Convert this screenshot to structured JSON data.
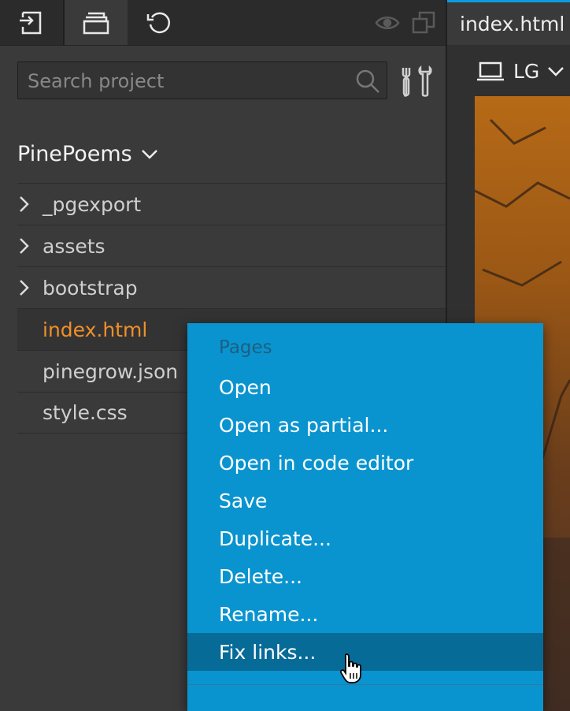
{
  "toolbar": {
    "buttons": [
      {
        "icon": "import-icon"
      },
      {
        "icon": "archive-icon"
      },
      {
        "icon": "refresh-icon"
      },
      {
        "icon": "eye-icon"
      },
      {
        "icon": "copy-icon"
      }
    ]
  },
  "search": {
    "placeholder": "Search project",
    "value": ""
  },
  "project": {
    "name": "PinePoems",
    "items": [
      {
        "label": "_pgexport",
        "type": "folder"
      },
      {
        "label": "assets",
        "type": "folder"
      },
      {
        "label": "bootstrap",
        "type": "folder"
      },
      {
        "label": "index.html",
        "type": "file",
        "active": true
      },
      {
        "label": "pinegrow.json",
        "type": "file"
      },
      {
        "label": "style.css",
        "type": "file"
      }
    ]
  },
  "editor": {
    "tab_label": "index.html *",
    "device_label": "LG",
    "accent_color": "#0d9be0"
  },
  "context_menu": {
    "header": "Pages",
    "items": [
      "Open",
      "Open as partial...",
      "Open in code editor",
      "Save",
      "Duplicate...",
      "Delete...",
      "Rename...",
      "Fix links..."
    ],
    "highlighted": "Fix links...",
    "background_color": "#0a94cf",
    "highlight_color": "#076b98"
  },
  "colors": {
    "active_file": "#f0902a"
  }
}
